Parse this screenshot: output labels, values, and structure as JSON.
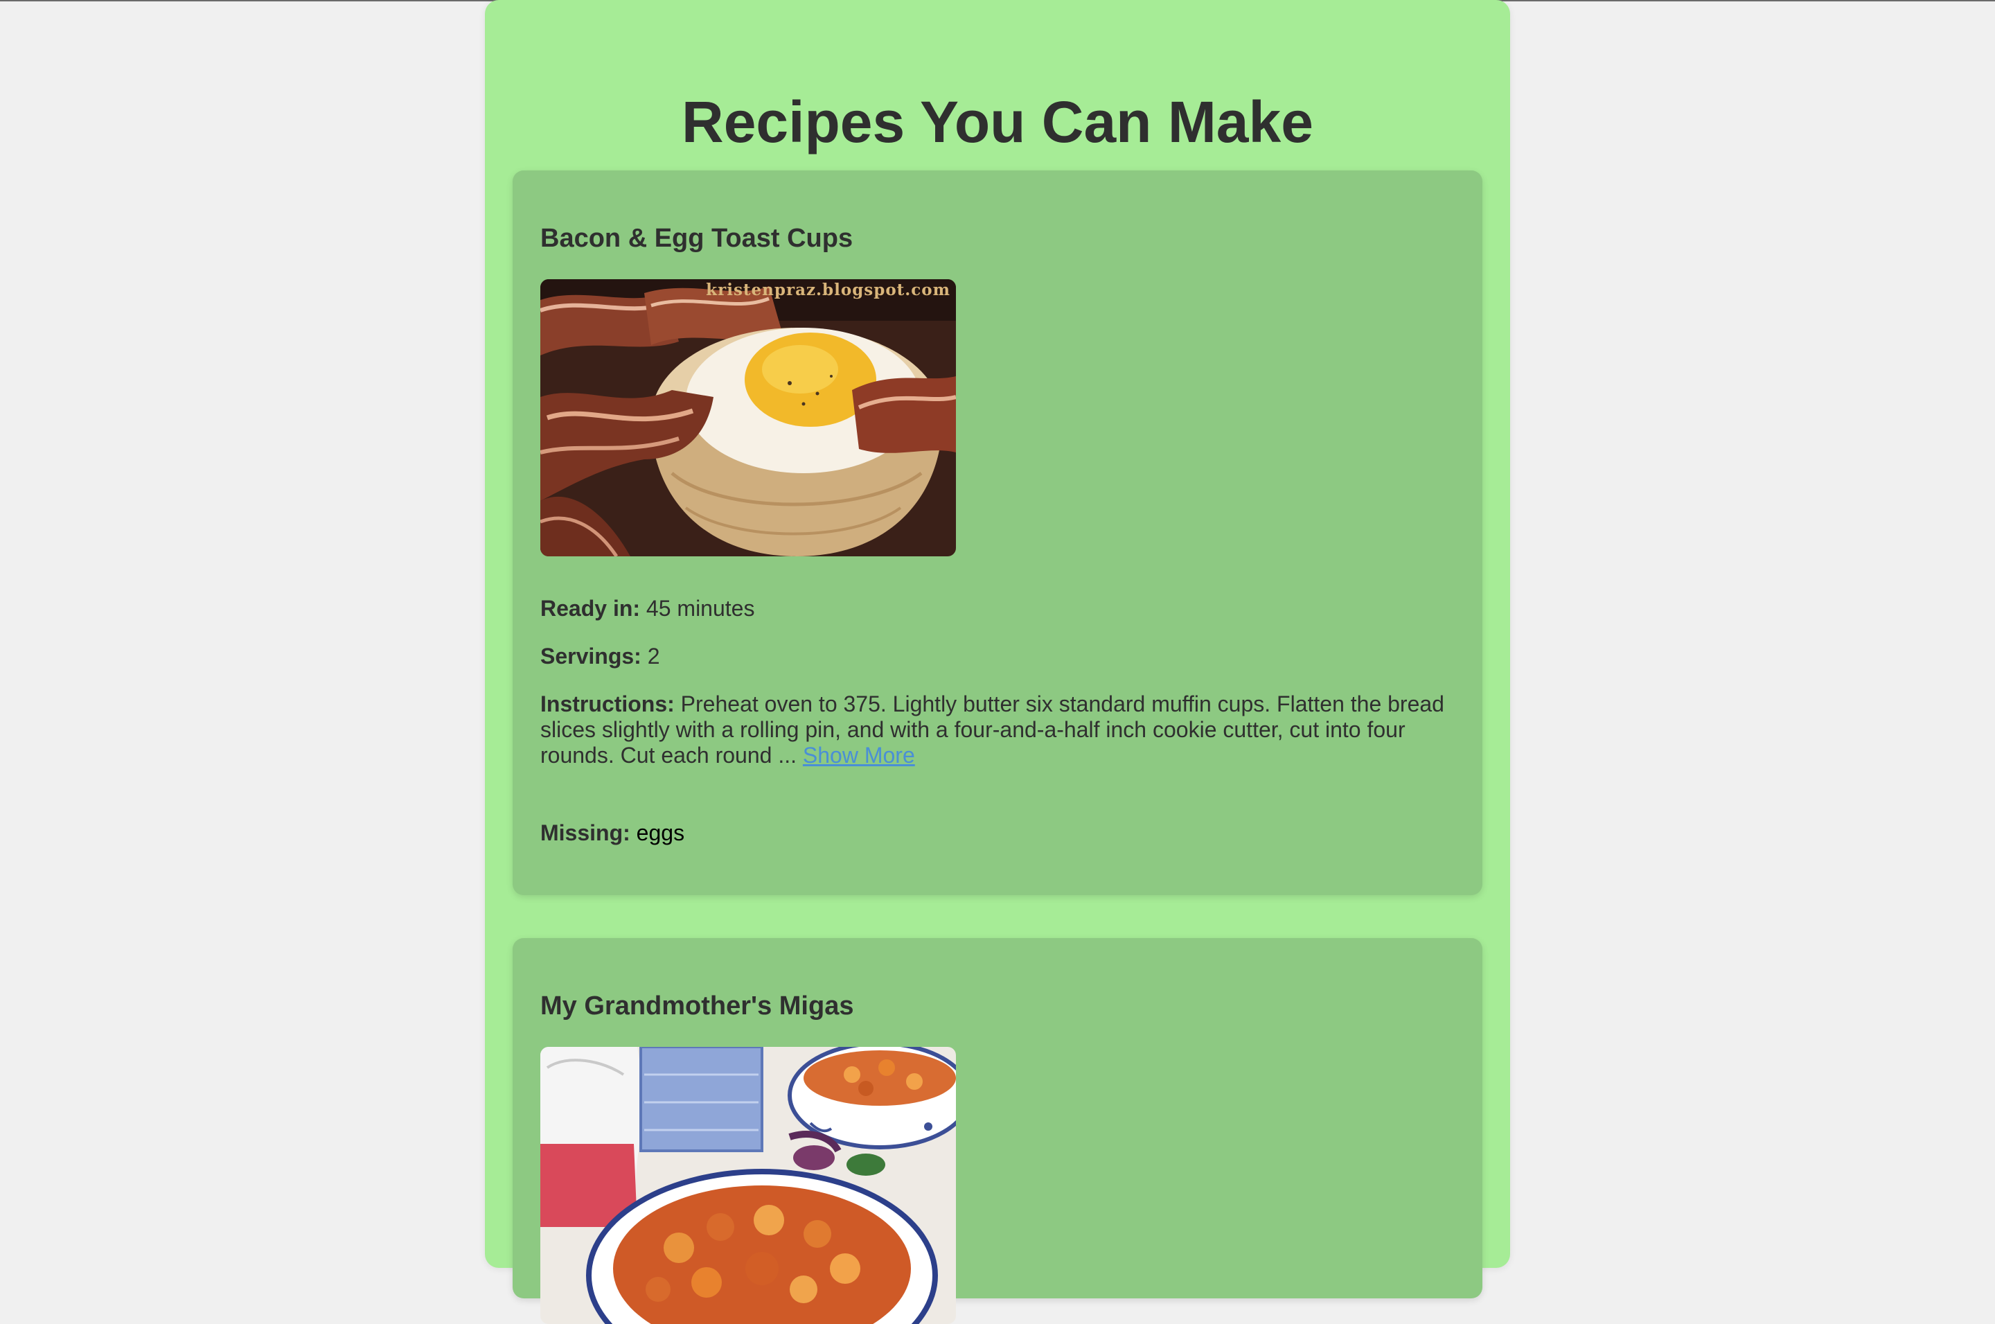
{
  "page": {
    "title": "Recipes You Can Make"
  },
  "labels": {
    "ready_in": "Ready in:",
    "servings": "Servings:",
    "instructions": "Instructions:",
    "missing": "Missing:",
    "show_more": "Show More"
  },
  "recipes": [
    {
      "title": "Bacon & Egg Toast Cups",
      "image_watermark": "kristenpraz.blogspot.com",
      "ready_in": "45 minutes",
      "servings": "2",
      "instructions": "Preheat oven to 375. Lightly butter six standard muffin cups. Flatten the bread slices slightly with a rolling pin, and with a four-and-a-half inch cookie cutter, cut into four rounds. Cut each round ...",
      "missing": "eggs"
    },
    {
      "title": "My Grandmother's Migas"
    }
  ],
  "colors": {
    "page_background": "#f0f0f0",
    "container_background": "#a6ec96",
    "card_background": "#8dc982",
    "text": "#2f2f2f",
    "link": "#4a8fd6"
  }
}
